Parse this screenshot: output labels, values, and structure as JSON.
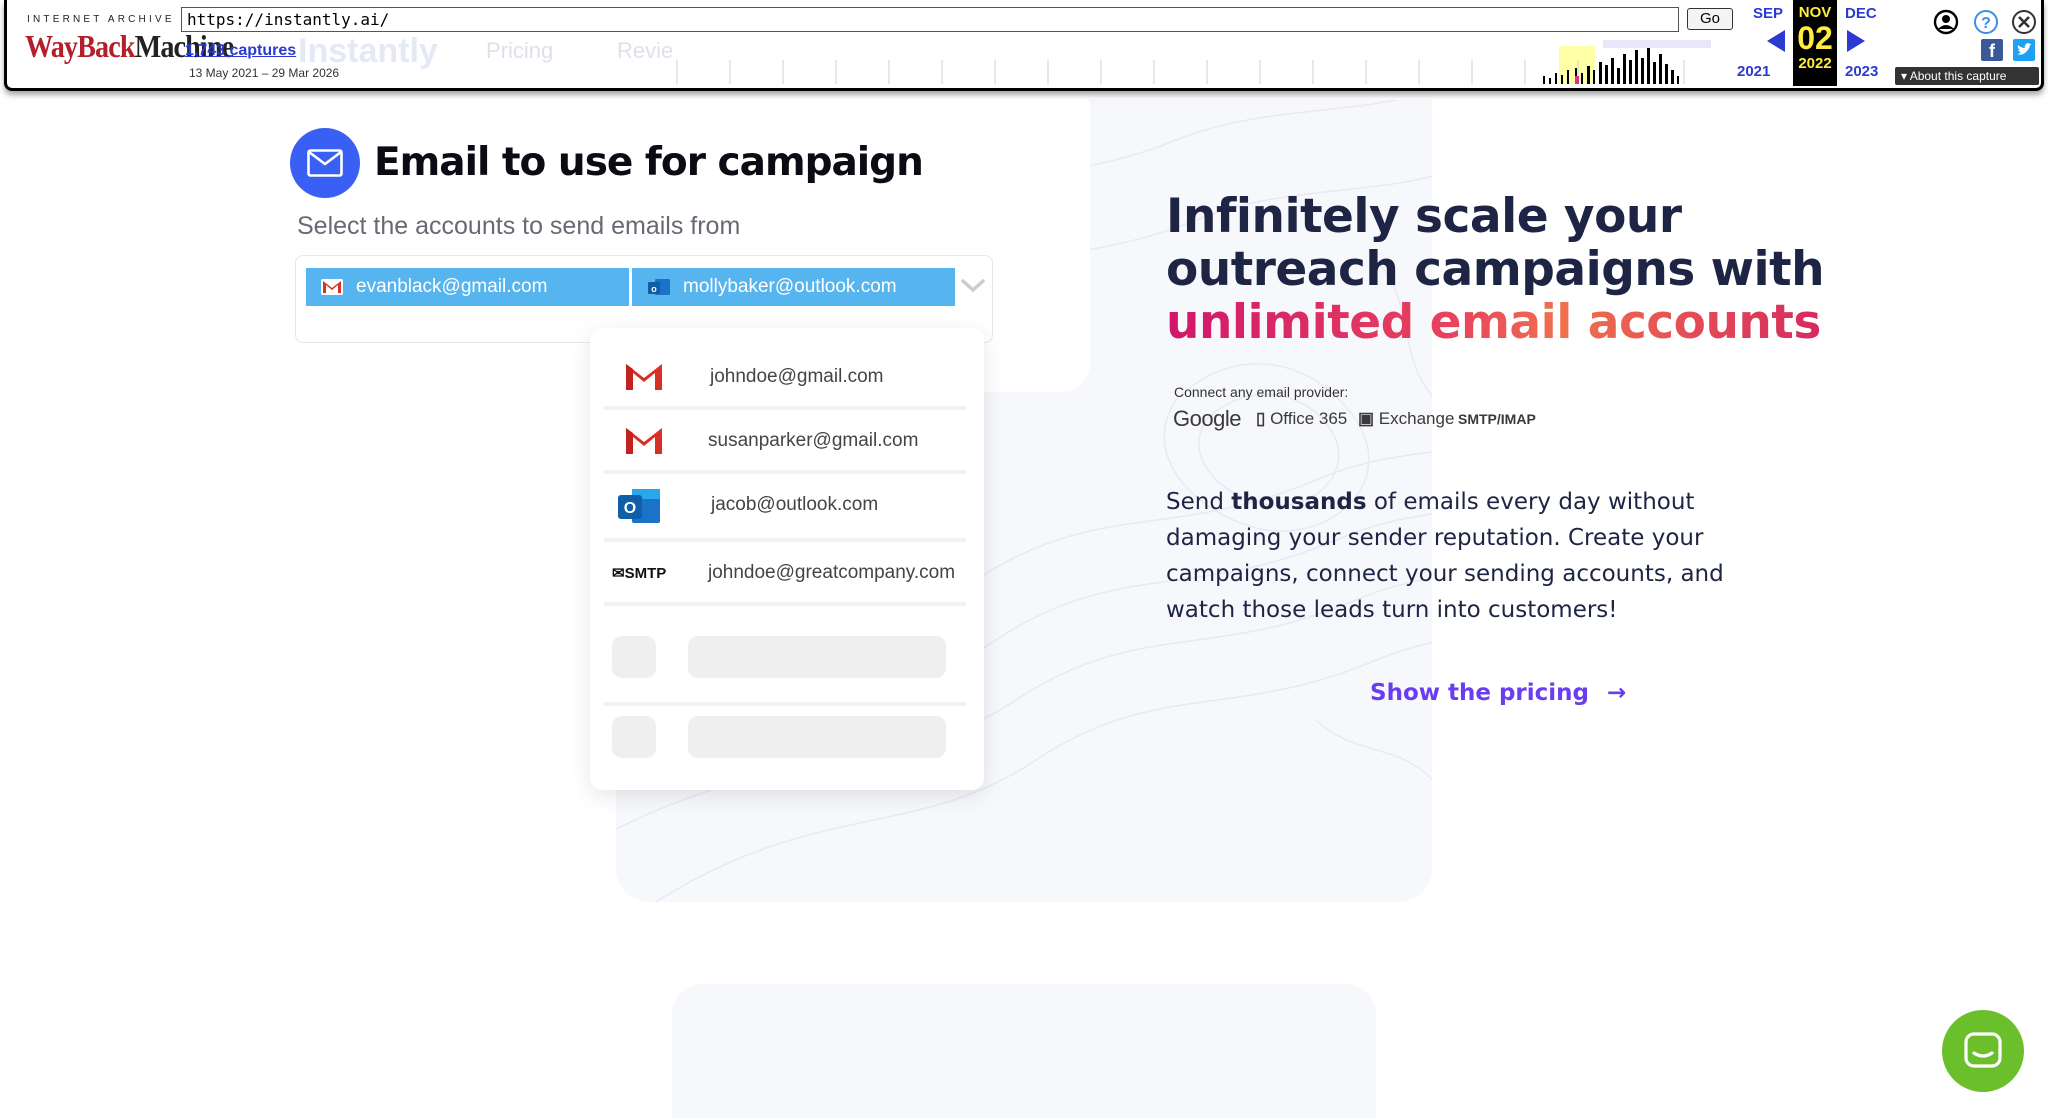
{
  "wayback": {
    "logo_top": "INTERNET ARCHIVE",
    "logo_main_red": "WayBack",
    "logo_main_dark": "Machine",
    "url": "https://instantly.ai/",
    "go_label": "Go",
    "captures": "1,743 captures",
    "date_range": "13 May 2021 – 29 Mar 2026",
    "prev_month": "SEP",
    "cur_month": "NOV",
    "next_month": "DEC",
    "cur_day": "02",
    "prev_year": "2021",
    "cur_year": "2022",
    "next_year": "2023",
    "about_label": "About this capture"
  },
  "site_nav": {
    "brand": "Instantly",
    "pricing": "Pricing",
    "reviews": "Revie"
  },
  "campaign": {
    "title": "Email to use for campaign",
    "subtitle": "Select the accounts to send emails from",
    "selected": [
      {
        "email": "evanblack@gmail.com",
        "icon": "gmail-icon"
      },
      {
        "email": "mollybaker@outlook.com",
        "icon": "outlook-icon"
      }
    ],
    "options": [
      {
        "email": "johndoe@gmail.com",
        "icon": "gmail-icon"
      },
      {
        "email": "susanparker@gmail.com",
        "icon": "gmail-icon"
      },
      {
        "email": "jacob@outlook.com",
        "icon": "outlook-icon"
      },
      {
        "email": "johndoe@greatcompany.com",
        "icon": "smtp-icon",
        "icon_text": "SMTP"
      }
    ]
  },
  "hero": {
    "line1": "Infinitely scale your",
    "line2": "outreach campaigns with",
    "line3": "unlimited email accounts",
    "provider_label": "Connect any email provider:",
    "providers": [
      "Google",
      "Office 365",
      "Exchange",
      "SMTP/IMAP"
    ],
    "body_prefix": "Send ",
    "body_bold": "thousands",
    "body_rest": " of emails every day without damaging your sender reputation. Create your campaigns, connect your sending accounts, and watch those leads turn into customers!",
    "cta": "Show the pricing",
    "cta_arrow": "→"
  },
  "colors": {
    "accent_blue": "#3a5ff5",
    "chip_blue": "#56b4ee",
    "cta_purple": "#6a3df0",
    "chat_green": "#6bbf2a",
    "heading_navy": "#1e2444"
  }
}
